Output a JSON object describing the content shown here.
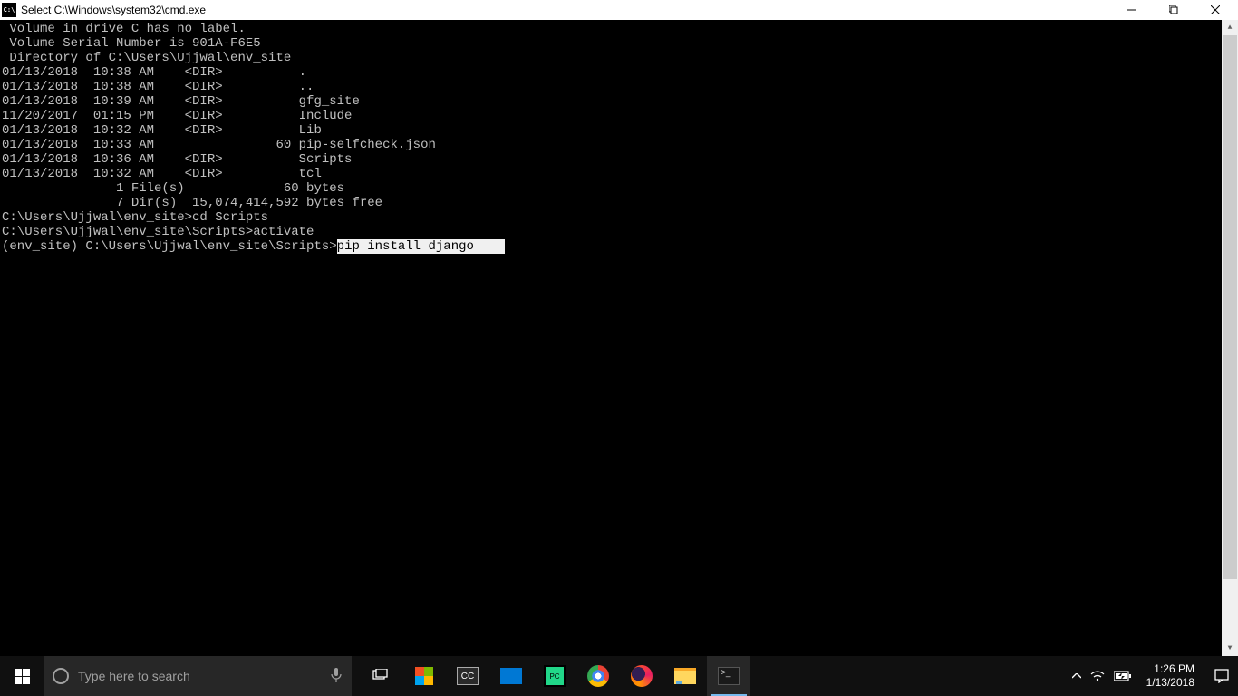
{
  "titlebar": {
    "icon_text": "C:\\",
    "title": "Select C:\\Windows\\system32\\cmd.exe"
  },
  "terminal": {
    "lines": [
      " Volume in drive C has no label.",
      " Volume Serial Number is 901A-F6E5",
      "",
      " Directory of C:\\Users\\Ujjwal\\env_site",
      "",
      "01/13/2018  10:38 AM    <DIR>          .",
      "01/13/2018  10:38 AM    <DIR>          ..",
      "01/13/2018  10:39 AM    <DIR>          gfg_site",
      "11/20/2017  01:15 PM    <DIR>          Include",
      "01/13/2018  10:32 AM    <DIR>          Lib",
      "01/13/2018  10:33 AM                60 pip-selfcheck.json",
      "01/13/2018  10:36 AM    <DIR>          Scripts",
      "01/13/2018  10:32 AM    <DIR>          tcl",
      "               1 File(s)             60 bytes",
      "               7 Dir(s)  15,074,414,592 bytes free",
      "",
      "C:\\Users\\Ujjwal\\env_site>cd Scripts",
      "",
      "C:\\Users\\Ujjwal\\env_site\\Scripts>activate",
      ""
    ],
    "final_prompt": "(env_site) C:\\Users\\Ujjwal\\env_site\\Scripts>",
    "typed_command": "pip install django",
    "selection_pad": "    "
  },
  "search": {
    "placeholder": "Type here to search"
  },
  "apps": {
    "cc": "CC",
    "pycharm": "PC",
    "cmd_glyph": ">_"
  },
  "tray": {
    "time": "1:26 PM",
    "date": "1/13/2018"
  }
}
